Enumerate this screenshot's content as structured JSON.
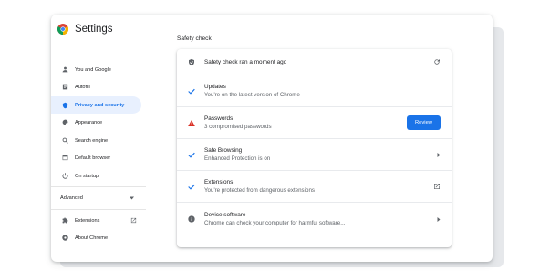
{
  "app": {
    "title": "Settings"
  },
  "sidebar": {
    "items": [
      {
        "label": "You and Google",
        "icon": "person-icon"
      },
      {
        "label": "Autofill",
        "icon": "autofill-icon"
      },
      {
        "label": "Privacy and security",
        "icon": "shield-icon",
        "active": true
      },
      {
        "label": "Appearance",
        "icon": "palette-icon"
      },
      {
        "label": "Search engine",
        "icon": "search-icon"
      },
      {
        "label": "Default browser",
        "icon": "browser-icon"
      },
      {
        "label": "On startup",
        "icon": "power-icon"
      }
    ],
    "advanced_label": "Advanced",
    "extensions_label": "Extensions",
    "about_label": "About Chrome"
  },
  "main": {
    "section_title": "Safety check",
    "header_row": {
      "text": "Safety check ran a moment ago",
      "icon": "shield-check-icon",
      "action_icon": "refresh-icon"
    },
    "rows": [
      {
        "title": "Updates",
        "subtitle": "You're on the latest version of Chrome",
        "icon": "checkmark-icon"
      },
      {
        "title": "Passwords",
        "subtitle": "3 compromised passwords",
        "icon": "warning-icon",
        "button": "Review"
      },
      {
        "title": "Safe Browsing",
        "subtitle": "Enhanced Protection is on",
        "icon": "checkmark-icon",
        "end_icon": "chevron-right-icon"
      },
      {
        "title": "Extensions",
        "subtitle": "You're protected from dangerous extensions",
        "icon": "checkmark-icon",
        "end_icon": "open-external-icon"
      },
      {
        "title": "Device software",
        "subtitle": "Chrome can check your computer for harmful software...",
        "icon": "info-icon",
        "end_icon": "chevron-right-icon"
      }
    ]
  },
  "colors": {
    "accent": "#1a73e8",
    "active_bg": "#e8f0fe",
    "warning": "#d93025",
    "check": "#1a73e8"
  }
}
